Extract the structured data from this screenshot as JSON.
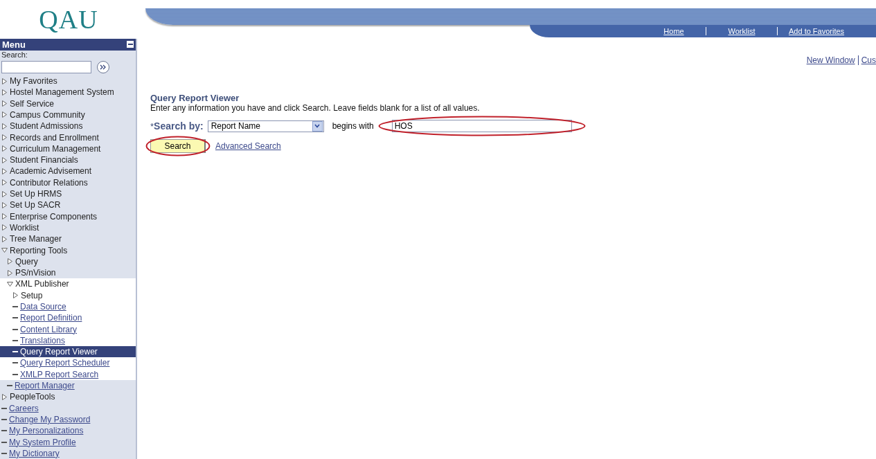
{
  "logo": "QAU",
  "menu": {
    "title": "Menu",
    "search_label": "Search:",
    "items": [
      {
        "kind": "folder",
        "label": "My Favorites",
        "expanded": false,
        "selected": false
      },
      {
        "kind": "folder",
        "label": "Hostel Management System",
        "expanded": false,
        "selected": false
      },
      {
        "kind": "folder",
        "label": "Self Service",
        "expanded": false,
        "selected": false
      },
      {
        "kind": "folder",
        "label": "Campus Community",
        "expanded": false,
        "selected": false
      },
      {
        "kind": "folder",
        "label": "Student Admissions",
        "expanded": false,
        "selected": false
      },
      {
        "kind": "folder",
        "label": "Records and Enrollment",
        "expanded": false,
        "selected": false
      },
      {
        "kind": "folder",
        "label": "Curriculum Management",
        "expanded": false,
        "selected": false
      },
      {
        "kind": "folder",
        "label": "Student Financials",
        "expanded": false,
        "selected": false
      },
      {
        "kind": "folder",
        "label": "Academic Advisement",
        "expanded": false,
        "selected": false
      },
      {
        "kind": "folder",
        "label": "Contributor Relations",
        "expanded": false,
        "selected": false
      },
      {
        "kind": "folder",
        "label": "Set Up HRMS",
        "expanded": false,
        "selected": false
      },
      {
        "kind": "folder",
        "label": "Set Up SACR",
        "expanded": false,
        "selected": false
      },
      {
        "kind": "folder",
        "label": "Enterprise Components",
        "expanded": false,
        "selected": false
      },
      {
        "kind": "folder",
        "label": "Worklist",
        "expanded": false,
        "selected": false
      },
      {
        "kind": "folder",
        "label": "Tree Manager",
        "expanded": false,
        "selected": false
      },
      {
        "kind": "folder",
        "label": "Reporting Tools",
        "expanded": true,
        "selected": false,
        "children": [
          {
            "kind": "folder",
            "label": "Query",
            "expanded": false,
            "selected": false
          },
          {
            "kind": "folder",
            "label": "PS/nVision",
            "expanded": false,
            "selected": false
          },
          {
            "kind": "folder",
            "label": "XML Publisher",
            "expanded": true,
            "selected": false,
            "children": [
              {
                "kind": "folder",
                "label": "Setup",
                "expanded": false,
                "selected": false
              },
              {
                "kind": "link",
                "label": "Data Source",
                "selected": false
              },
              {
                "kind": "link",
                "label": "Report Definition",
                "selected": false
              },
              {
                "kind": "link",
                "label": "Content Library",
                "selected": false
              },
              {
                "kind": "link",
                "label": "Translations",
                "selected": false
              },
              {
                "kind": "link",
                "label": "Query Report Viewer",
                "selected": true
              },
              {
                "kind": "link",
                "label": "Query Report Scheduler",
                "selected": false
              },
              {
                "kind": "link",
                "label": "XMLP Report Search",
                "selected": false
              }
            ]
          },
          {
            "kind": "link",
            "label": "Report Manager",
            "selected": false
          }
        ]
      },
      {
        "kind": "folder",
        "label": "PeopleTools",
        "expanded": false,
        "selected": false
      },
      {
        "kind": "link",
        "label": "Careers",
        "selected": false
      },
      {
        "kind": "link",
        "label": "Change My Password",
        "selected": false
      },
      {
        "kind": "link",
        "label": "My Personalizations",
        "selected": false
      },
      {
        "kind": "link",
        "label": "My System Profile",
        "selected": false
      },
      {
        "kind": "link",
        "label": "My Dictionary",
        "selected": false
      }
    ]
  },
  "nav": [
    "Home",
    "Worklist",
    "Add to Favorites"
  ],
  "page_links": [
    "New Window",
    "Cus"
  ],
  "page": {
    "title": "Query Report Viewer",
    "instructions": "Enter any information you have and click Search. Leave fields blank for a list of all values.",
    "required_mark": "*",
    "search_by_label": "Search by:",
    "search_by_value": "Report Name",
    "operator": "begins with",
    "value": "HOS",
    "value_highlighted": true,
    "search_button": "Search",
    "search_button_highlighted": true,
    "advanced_link": "Advanced Search"
  }
}
